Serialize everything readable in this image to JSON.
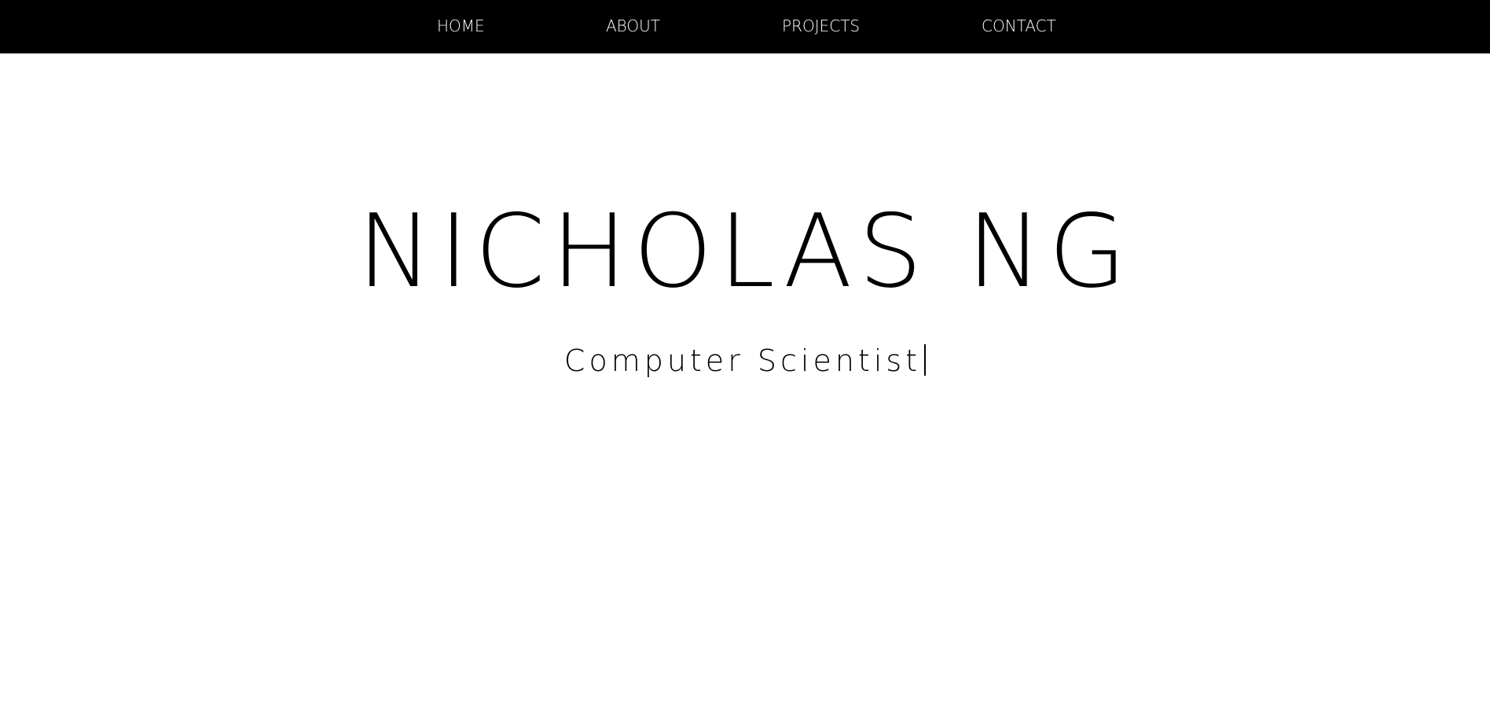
{
  "nav": {
    "items": [
      {
        "label": "HOME"
      },
      {
        "label": "ABOUT"
      },
      {
        "label": "PROJECTS"
      },
      {
        "label": "CONTACT"
      }
    ]
  },
  "hero": {
    "name": "NICHOLAS NG",
    "subtitle": "Computer Scientist"
  },
  "colors": {
    "nav_background": "#000000",
    "nav_text": "#ffffff",
    "page_background": "#ffffff",
    "text": "#000000"
  }
}
